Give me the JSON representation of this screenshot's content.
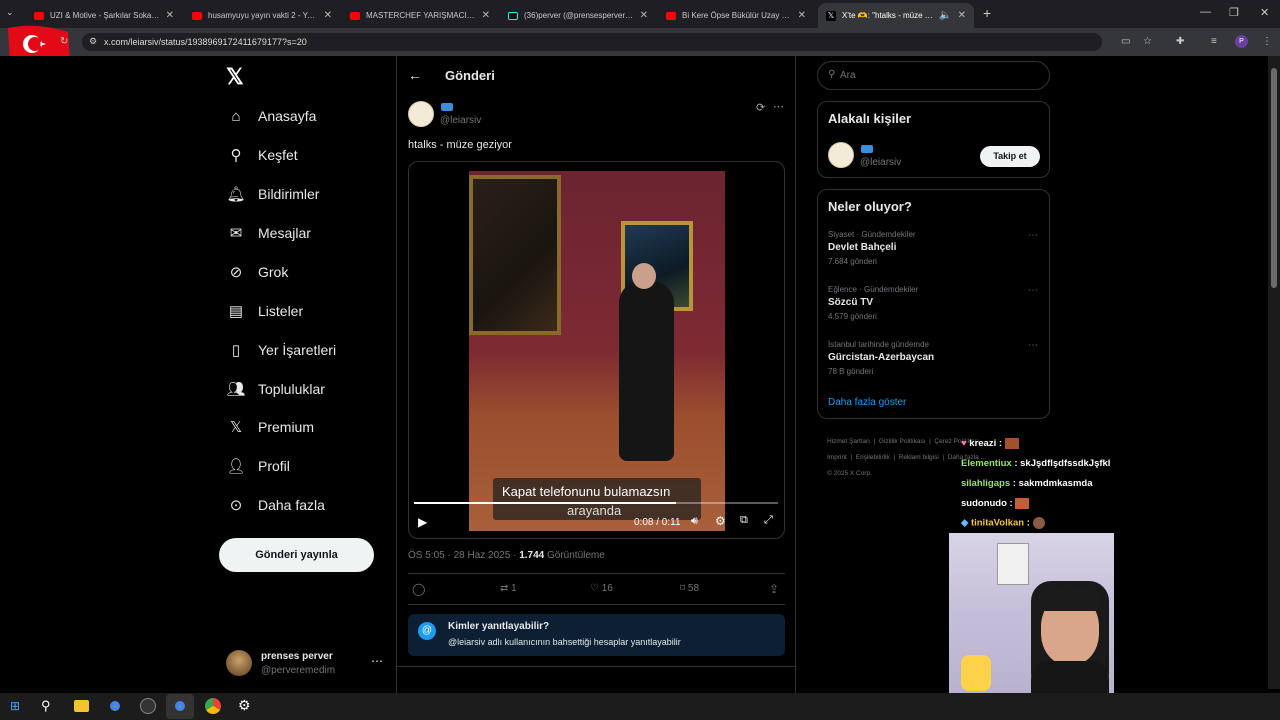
{
  "browser": {
    "tabs": [
      {
        "title": "UZI & Motive - Şarkılar Sokakla"
      },
      {
        "title": "husamyuyu yayın vakti 2 - YouT"
      },
      {
        "title": "MASTERCHEF YARIŞMACILARIN"
      },
      {
        "title": "(36)perver (@prensesperver) | T"
      },
      {
        "title": "Bi Kere Öpse Bükülür Uzay (Big"
      },
      {
        "title": "X'te 🫶: \"htalks - müze gez"
      }
    ],
    "url": "x.com/leiarsiv/status/1938969172411679177?s=20"
  },
  "sidebar": {
    "items": [
      {
        "label": "Anasayfa"
      },
      {
        "label": "Keşfet"
      },
      {
        "label": "Bildirimler"
      },
      {
        "label": "Mesajlar"
      },
      {
        "label": "Grok"
      },
      {
        "label": "Listeler"
      },
      {
        "label": "Yer İşaretleri"
      },
      {
        "label": "Topluluklar"
      },
      {
        "label": "Premium"
      },
      {
        "label": "Profil"
      },
      {
        "label": "Daha fazla"
      }
    ],
    "post_button": "Gönderi yayınla",
    "account": {
      "name": "prenses perver",
      "handle": "@perveremedim"
    }
  },
  "post": {
    "header_title": "Gönderi",
    "author_handle": "@leiarsiv",
    "text": "htalks - müze geziyor",
    "caption_line1": "Kapat telefonunu bulamazsın",
    "caption_line2": "arayanda",
    "time_display": "0:08 / 0:11",
    "progress": 0.72,
    "date": "ÖS 5:05 · 28 Haz 2025 ·",
    "views": "1.744",
    "views_label": "Görüntüleme",
    "retweets": "1",
    "likes": "16",
    "bookmarks": "58",
    "reply_box": {
      "title": "Kimler yanıtlayabilir?",
      "body": "@leiarsiv adlı kullanıcının bahsettiği hesaplar yanıtlayabilir"
    }
  },
  "right": {
    "search_placeholder": "Ara",
    "related": {
      "title": "Alakalı kişiler",
      "handle": "@leiarsiv",
      "follow_label": "Takip et"
    },
    "trends": {
      "title": "Neler oluyor?",
      "items": [
        {
          "category": "Siyaset · Gündemdekiler",
          "name": "Devlet Bahçeli",
          "count": "7.684 gönderi"
        },
        {
          "category": "Eğlence · Gündemdekiler",
          "name": "Sözcü TV",
          "count": "4.579 gönderi"
        },
        {
          "category": "İstanbul tarihinde gündemde",
          "name": "Gürcistan-Azerbaycan",
          "count": "78 B gönderi"
        }
      ],
      "show_more": "Daha fazla göster"
    },
    "footer": {
      "links": [
        "Hizmet Şartları",
        "Gizlilik Politikası",
        "Çerez Politikası",
        "Imprint",
        "Erişilebilirlik",
        "Reklam bilgisi",
        "Daha fazla ..."
      ],
      "copyright": "© 2025 X Corp."
    }
  },
  "chat": {
    "messages": [
      {
        "user": "kreazi",
        "text": ""
      },
      {
        "user": "Elementiux",
        "text": "skJşdflşdfssdkJşfkl",
        "color": "#9be36b"
      },
      {
        "user": "silahligaps",
        "text": "sakmdmkasmda",
        "color": "#9be36b"
      },
      {
        "user": "sudonudo",
        "text": "",
        "color": "#ffffff"
      },
      {
        "user": "tinitaVolkan",
        "text": "",
        "color": "#f5c542"
      }
    ]
  },
  "colors": {
    "accent": "#1d9bf0",
    "background": "#000000",
    "border": "#2f3336"
  }
}
